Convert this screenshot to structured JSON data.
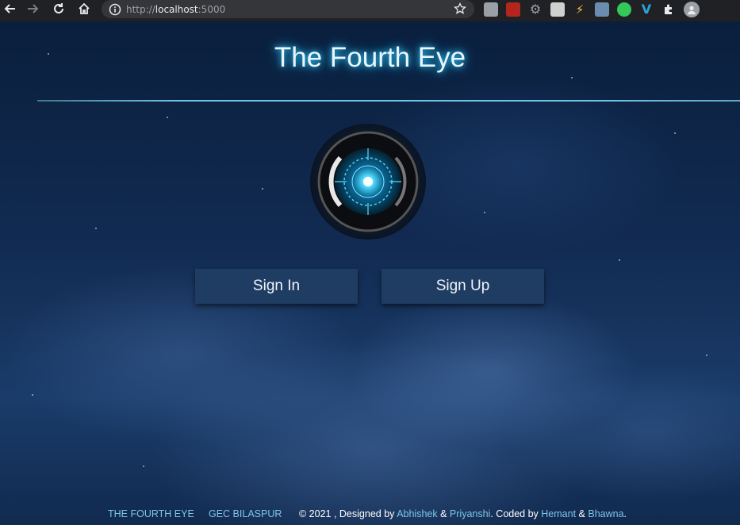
{
  "browser": {
    "url_scheme": "http://",
    "url_host": "localhost",
    "url_port": ":5000"
  },
  "page": {
    "title": "The Fourth Eye",
    "buttons": {
      "sign_in": "Sign In",
      "sign_up": "Sign Up"
    },
    "footer": {
      "link1": "THE FOURTH EYE",
      "link2": "GEC BILASPUR",
      "credit_prefix": "© 2021 , Designed by ",
      "designer1": "Abhishek",
      "amp1": " & ",
      "designer2": "Priyanshi",
      "coded_by": ". Coded by ",
      "coder1": "Hemant",
      "amp2": " & ",
      "coder2": "Bhawna",
      "end": "."
    }
  },
  "colors": {
    "title_glow": "#31d3ff",
    "footer_link": "#7cc6e8",
    "button_bg": "#1f3d63"
  },
  "icons": [
    "back-arrow-icon",
    "forward-arrow-icon",
    "reload-icon",
    "home-icon",
    "info-icon",
    "star-icon",
    "extensions-icon",
    "profile-icon"
  ]
}
